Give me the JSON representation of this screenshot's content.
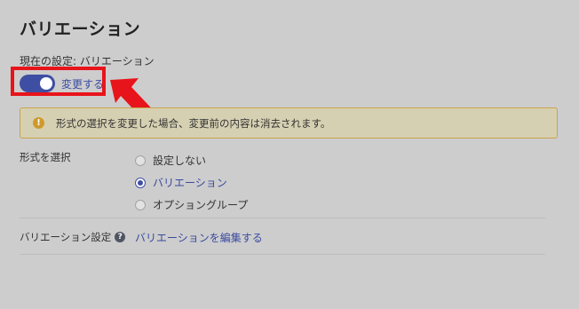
{
  "page": {
    "title": "バリエーション",
    "current_setting": "現在の設定: バリエーション"
  },
  "toggle": {
    "label": "変更する",
    "state": "on",
    "color": "#3e4fa3"
  },
  "warning": {
    "icon": "info-icon",
    "icon_glyph": "!",
    "text": "形式の選択を変更した場合、変更前の内容は消去されます。",
    "background": "#d6d0b2",
    "border_color": "#c9a44b"
  },
  "format_select": {
    "label": "形式を選択",
    "options": [
      {
        "label": "設定しない",
        "selected": false
      },
      {
        "label": "バリエーション",
        "selected": true
      },
      {
        "label": "オプショングループ",
        "selected": false
      }
    ]
  },
  "variation_setting": {
    "label": "バリエーション設定",
    "help_icon": "question-icon",
    "help_glyph": "?",
    "edit_link": "バリエーションを編集する"
  },
  "annotation": {
    "highlight_color": "#e8141b",
    "arrow_icon": "red-arrow-icon"
  }
}
